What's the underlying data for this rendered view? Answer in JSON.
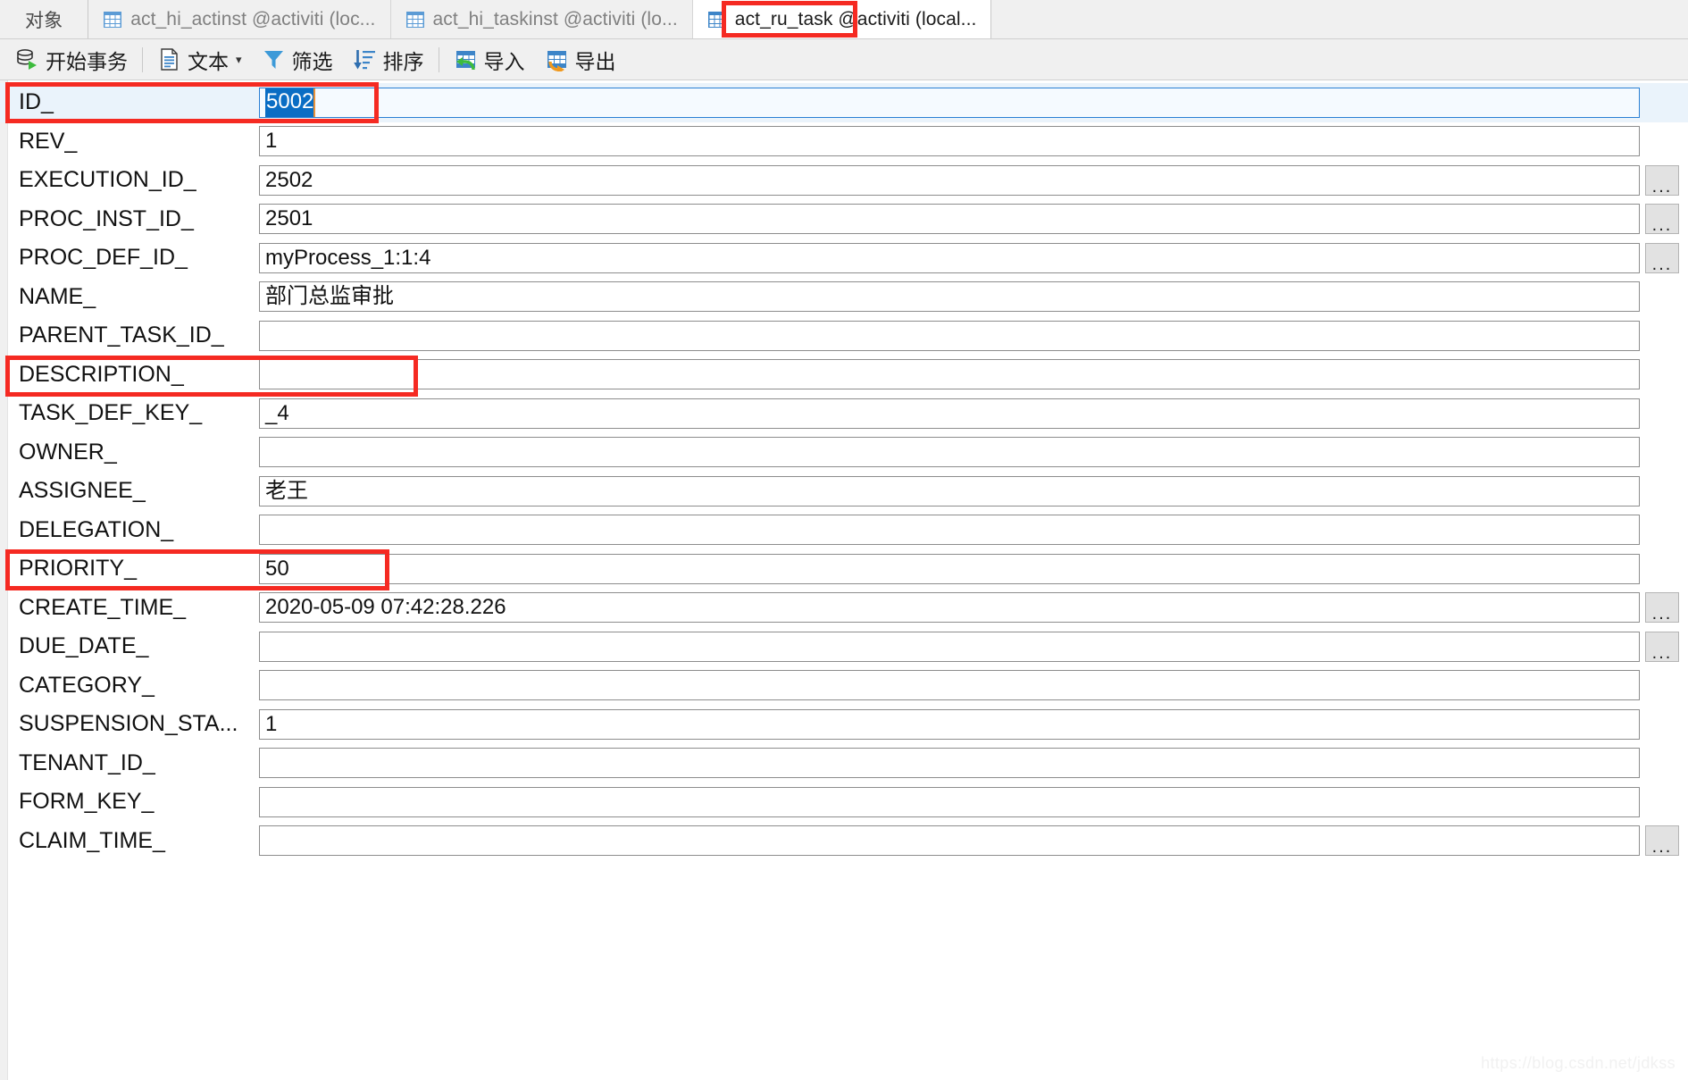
{
  "window": {
    "tabs": [
      {
        "label": "对象",
        "icon": "none",
        "active": false,
        "kind": "objects"
      },
      {
        "label": "act_hi_actinst @activiti (loc...",
        "icon": "table-icon",
        "active": false,
        "kind": "table"
      },
      {
        "label": "act_hi_taskinst @activiti (lo...",
        "icon": "table-icon",
        "active": false,
        "kind": "table"
      },
      {
        "label": "act_ru_task @activiti (local...",
        "icon": "table-icon",
        "active": true,
        "kind": "table",
        "highlight_text": "act_ru_task"
      }
    ]
  },
  "toolbar": {
    "items": [
      {
        "label": "开始事务",
        "icon": "begin-transaction-icon",
        "caret": false
      },
      {
        "label": "文本",
        "icon": "text-icon",
        "caret": true
      },
      {
        "label": "筛选",
        "icon": "filter-icon",
        "caret": false
      },
      {
        "label": "排序",
        "icon": "sort-icon",
        "caret": false
      },
      {
        "label": "导入",
        "icon": "import-icon",
        "caret": false
      },
      {
        "label": "导出",
        "icon": "export-icon",
        "caret": false
      }
    ],
    "separators_after": [
      0,
      4
    ]
  },
  "form": {
    "focused_field": "ID_",
    "ellipsis_button_label": "...",
    "fields": [
      {
        "label": "ID_",
        "value": "5002",
        "selected": true,
        "dots": false,
        "focused": true
      },
      {
        "label": "REV_",
        "value": "1",
        "selected": false,
        "dots": false,
        "focused": false
      },
      {
        "label": "EXECUTION_ID_",
        "value": "2502",
        "selected": false,
        "dots": true,
        "focused": false
      },
      {
        "label": "PROC_INST_ID_",
        "value": "2501",
        "selected": false,
        "dots": true,
        "focused": false
      },
      {
        "label": "PROC_DEF_ID_",
        "value": "myProcess_1:1:4",
        "selected": false,
        "dots": true,
        "focused": false
      },
      {
        "label": "NAME_",
        "value": "部门总监审批",
        "selected": false,
        "dots": false,
        "focused": false
      },
      {
        "label": "PARENT_TASK_ID_",
        "value": "",
        "selected": false,
        "dots": false,
        "focused": false
      },
      {
        "label": "DESCRIPTION_",
        "value": "",
        "selected": false,
        "dots": false,
        "focused": false
      },
      {
        "label": "TASK_DEF_KEY_",
        "value": "_4",
        "selected": false,
        "dots": false,
        "focused": false
      },
      {
        "label": "OWNER_",
        "value": "",
        "selected": false,
        "dots": false,
        "focused": false
      },
      {
        "label": "ASSIGNEE_",
        "value": "老王",
        "selected": false,
        "dots": false,
        "focused": false
      },
      {
        "label": "DELEGATION_",
        "value": "",
        "selected": false,
        "dots": false,
        "focused": false
      },
      {
        "label": "PRIORITY_",
        "value": "50",
        "selected": false,
        "dots": false,
        "focused": false
      },
      {
        "label": "CREATE_TIME_",
        "value": "2020-05-09 07:42:28.226",
        "selected": false,
        "dots": true,
        "focused": false
      },
      {
        "label": "DUE_DATE_",
        "value": "",
        "selected": false,
        "dots": true,
        "focused": false
      },
      {
        "label": "CATEGORY_",
        "value": "",
        "selected": false,
        "dots": false,
        "focused": false
      },
      {
        "label": "SUSPENSION_STA...",
        "value": "1",
        "selected": false,
        "dots": false,
        "focused": false
      },
      {
        "label": "TENANT_ID_",
        "value": "",
        "selected": false,
        "dots": false,
        "focused": false
      },
      {
        "label": "FORM_KEY_",
        "value": "",
        "selected": false,
        "dots": false,
        "focused": false
      },
      {
        "label": "CLAIM_TIME_",
        "value": "",
        "selected": false,
        "dots": true,
        "focused": false
      }
    ]
  },
  "annotations": {
    "color": "#f52a22",
    "boxes": [
      {
        "target": "tab-act-ru-task",
        "note": "red box around active tab name"
      },
      {
        "target": "field-row-ID_",
        "note": "red box around ID_ row"
      },
      {
        "target": "field-row-NAME_",
        "note": "red box around NAME_ row"
      },
      {
        "target": "field-row-ASSIGNEE_",
        "note": "red box around ASSIGNEE_ row"
      }
    ]
  },
  "watermark": {
    "text": "https://blog.csdn.net/jdkss"
  }
}
